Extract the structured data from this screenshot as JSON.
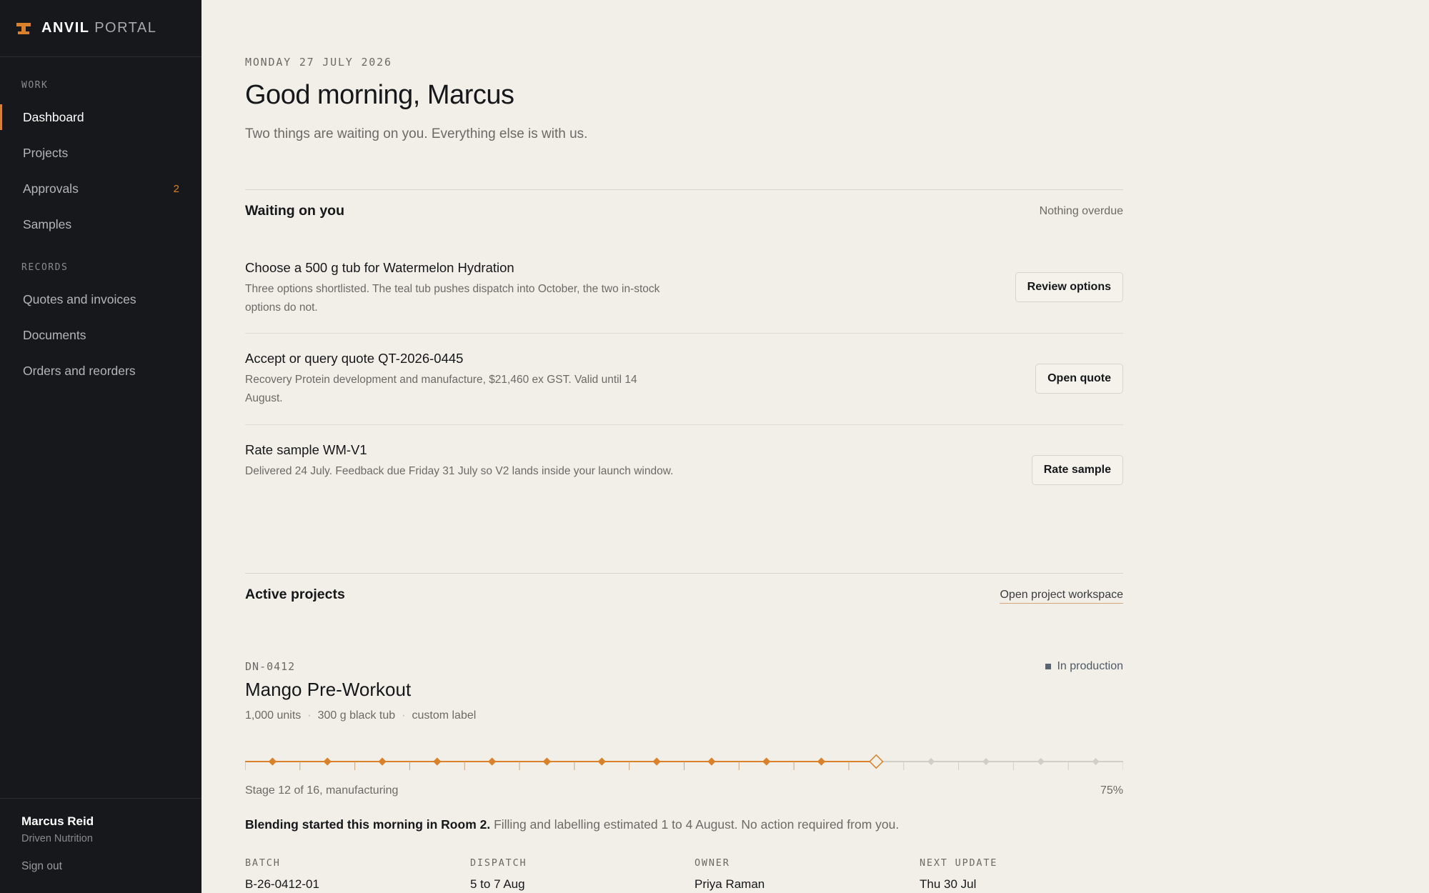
{
  "brand": {
    "name": "ANVIL",
    "suffix": "PORTAL",
    "accent": "#d9822b"
  },
  "sidebar": {
    "work_heading": "WORK",
    "work_items": [
      {
        "label": "Dashboard",
        "active": true
      },
      {
        "label": "Projects"
      },
      {
        "label": "Approvals",
        "badge": "2"
      },
      {
        "label": "Samples"
      }
    ],
    "records_heading": "RECORDS",
    "records_items": [
      {
        "label": "Quotes and invoices"
      },
      {
        "label": "Documents"
      },
      {
        "label": "Orders and reorders"
      }
    ],
    "user": {
      "name": "Marcus Reid",
      "org": "Driven Nutrition",
      "signout": "Sign out"
    }
  },
  "header": {
    "date": "MONDAY 27 JULY 2026",
    "greeting": "Good morning, Marcus",
    "subline": "Two things are waiting on you. Everything else is with us."
  },
  "waiting": {
    "title": "Waiting on you",
    "meta": "Nothing overdue",
    "tasks": [
      {
        "title": "Choose a 500 g tub for Watermelon Hydration",
        "desc": "Three options shortlisted. The teal tub pushes dispatch into October, the two in-stock options do not.",
        "action": "Review options"
      },
      {
        "title": "Accept or query quote QT-2026-0445",
        "desc": "Recovery Protein development and manufacture, $21,460 ex GST. Valid until 14 August.",
        "action": "Open quote"
      },
      {
        "title": "Rate sample WM-V1",
        "desc": "Delivered 24 July. Feedback due Friday 31 July so V2 lands inside your launch window.",
        "action": "Rate sample"
      }
    ]
  },
  "projects": {
    "title": "Active projects",
    "link": "Open project workspace",
    "active": {
      "code": "DN-0412",
      "name": "Mango Pre-Workout",
      "specs": [
        "1,000 units",
        "300 g black tub",
        "custom label"
      ],
      "status": "In production",
      "stage_current": 12,
      "stage_total": 16,
      "stage_label": "Stage 12 of 16, manufacturing",
      "progress_pct": "75%",
      "note_bold": "Blending started this morning in Room 2.",
      "note_rest": " Filling and labelling estimated 1 to 4 August. No action required from you.",
      "facts": [
        {
          "label": "BATCH",
          "value": "B-26-0412-01"
        },
        {
          "label": "DISPATCH",
          "value": "5 to 7 Aug"
        },
        {
          "label": "OWNER",
          "value": "Priya Raman"
        },
        {
          "label": "NEXT UPDATE",
          "value": "Thu 30 Jul"
        }
      ]
    }
  }
}
